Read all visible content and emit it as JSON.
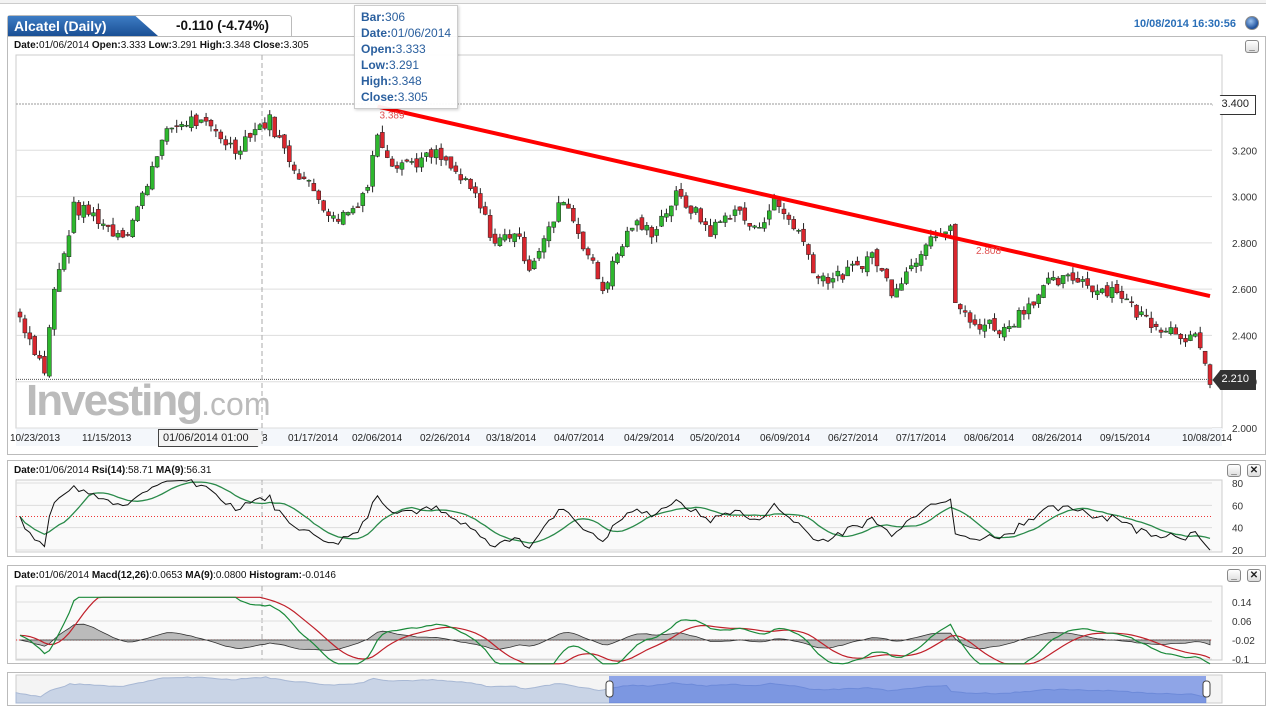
{
  "header": {
    "title": "Alcatel (Daily)",
    "change": "-0.110 (-4.74%)",
    "timestamp": "10/08/2014 16:30:56"
  },
  "main_panel": {
    "info": {
      "date_label": "Date:",
      "date": "01/06/2014",
      "open_label": "Open:",
      "open": "3.333",
      "low_label": "Low:",
      "low": "3.291",
      "high_label": "High:",
      "high": "3.348",
      "close_label": "Close:",
      "close": "3.305"
    },
    "last_price": "2.210",
    "cursor_price": "3.400",
    "cursor_date": "01/06/2014 01:00",
    "watermark": "Investing.com"
  },
  "tooltip": {
    "bar_label": "Bar:",
    "bar": "306",
    "date_label": "Date:",
    "date": "01/06/2014",
    "open_label": "Open:",
    "open": "3.333",
    "low_label": "Low:",
    "low": "3.291",
    "high_label": "High:",
    "high": "3.348",
    "close_label": "Close:",
    "close": "3.305"
  },
  "rsi_panel": {
    "date_label": "Date:",
    "date": "01/06/2014",
    "name": "Rsi(14)",
    "value": ":58.71",
    "ma_name": "MA(9)",
    "ma_value": ":56.31"
  },
  "macd_panel": {
    "date_label": "Date:",
    "date": "01/06/2014",
    "name": "Macd(12,26)",
    "value": ":0.0653",
    "ma_name": "MA(9)",
    "ma_value": ":0.0800",
    "hist_name": "Histogram:",
    "hist_value": "-0.0146"
  },
  "colors": {
    "up": "#2eb82e",
    "down": "#d9262e",
    "trendline": "#ff0000",
    "accent": "#2a6fb8"
  },
  "chart_data": [
    {
      "type": "candlestick",
      "title": "Alcatel (Daily)",
      "ylim": [
        2.0,
        3.4
      ],
      "yticks": [
        "3.400",
        "3.200",
        "3.000",
        "2.800",
        "2.600",
        "2.400",
        "2.200",
        "2.000"
      ],
      "xticks": [
        "10/23/2013",
        "11/15/2013",
        "12",
        "3",
        "01/17/2014",
        "02/06/2014",
        "02/26/2014",
        "03/18/2014",
        "04/07/2014",
        "04/29/2014",
        "05/20/2014",
        "06/09/2014",
        "06/27/2014",
        "07/17/2014",
        "08/06/2014",
        "08/26/2014",
        "09/15/2014",
        "10/08/2014"
      ],
      "bars": 244,
      "close_path": [
        [
          0,
          2.48
        ],
        [
          5,
          2.25
        ],
        [
          7,
          2.6
        ],
        [
          9,
          2.75
        ],
        [
          11,
          2.95
        ],
        [
          15,
          2.92
        ],
        [
          19,
          2.85
        ],
        [
          22,
          2.85
        ],
        [
          25,
          3.0
        ],
        [
          28,
          3.2
        ],
        [
          31,
          3.3
        ],
        [
          35,
          3.33
        ],
        [
          40,
          3.28
        ],
        [
          44,
          3.2
        ],
        [
          47,
          3.28
        ],
        [
          51,
          3.33
        ],
        [
          54,
          3.2
        ],
        [
          57,
          3.1
        ],
        [
          61,
          3.0
        ],
        [
          64,
          2.9
        ],
        [
          68,
          2.95
        ],
        [
          71,
          3.05
        ],
        [
          73,
          3.28
        ],
        [
          76,
          3.15
        ],
        [
          81,
          3.15
        ],
        [
          85,
          3.18
        ],
        [
          89,
          3.1
        ],
        [
          93,
          3.0
        ],
        [
          97,
          2.8
        ],
        [
          101,
          2.85
        ],
        [
          104,
          2.7
        ],
        [
          108,
          2.85
        ],
        [
          111,
          3.0
        ],
        [
          114,
          2.85
        ],
        [
          119,
          2.6
        ],
        [
          122,
          2.75
        ],
        [
          125,
          2.88
        ],
        [
          129,
          2.85
        ],
        [
          134,
          3.0
        ],
        [
          137,
          2.95
        ],
        [
          141,
          2.85
        ],
        [
          146,
          2.95
        ],
        [
          150,
          2.85
        ],
        [
          154,
          2.98
        ],
        [
          159,
          2.85
        ],
        [
          163,
          2.65
        ],
        [
          167,
          2.65
        ],
        [
          171,
          2.7
        ],
        [
          174,
          2.75
        ],
        [
          178,
          2.6
        ],
        [
          182,
          2.7
        ],
        [
          186,
          2.85
        ],
        [
          190,
          2.85
        ],
        [
          191,
          2.55
        ],
        [
          194,
          2.45
        ],
        [
          198,
          2.45
        ],
        [
          201,
          2.42
        ],
        [
          205,
          2.52
        ],
        [
          210,
          2.62
        ],
        [
          216,
          2.65
        ],
        [
          220,
          2.6
        ],
        [
          224,
          2.6
        ],
        [
          228,
          2.5
        ],
        [
          232,
          2.45
        ],
        [
          236,
          2.42
        ],
        [
          240,
          2.38
        ],
        [
          243,
          2.21
        ]
      ],
      "trendline": {
        "start": [
          73,
          3.389
        ],
        "end": [
          243,
          2.57
        ],
        "labels": [
          "3.389",
          "2.808"
        ]
      }
    },
    {
      "type": "line",
      "title": "RSI",
      "series": [
        {
          "name": "Rsi(14)",
          "color": "#111"
        },
        {
          "name": "MA(9)",
          "color": "#2a8a4a"
        }
      ],
      "ylim": [
        20,
        80
      ],
      "yticks": [
        "80",
        "60",
        "40",
        "20"
      ],
      "reference": 50
    },
    {
      "type": "line",
      "title": "MACD",
      "series": [
        {
          "name": "Macd(12,26)",
          "color": "#1a8a3a"
        },
        {
          "name": "MA(9)",
          "color": "#c0202a"
        },
        {
          "name": "Histogram",
          "color": "#888"
        }
      ],
      "ylim": [
        -0.1,
        0.14
      ],
      "yticks": [
        "0.14",
        "0.06",
        "-0.02",
        "-0.1"
      ]
    }
  ],
  "navigator": {
    "range_start_fraction": 0.5,
    "range_end_fraction": 1.0
  }
}
